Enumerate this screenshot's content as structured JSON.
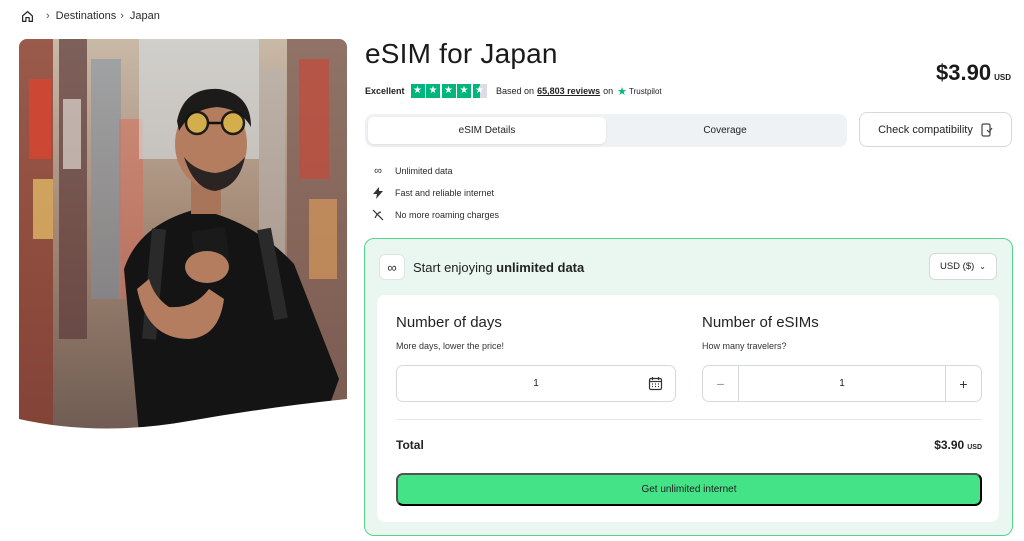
{
  "breadcrumb": {
    "home_icon": "home-icon",
    "items": [
      "Destinations",
      "Japan"
    ]
  },
  "product": {
    "title": "eSIM for Japan",
    "price": "$3.90",
    "currency": "USD"
  },
  "trustpilot": {
    "rating_text": "Excellent",
    "stars": 4.5,
    "based_on": "Based on",
    "review_count": "65,803 reviews",
    "on": "on",
    "brand": "Trustpilot"
  },
  "tabs": [
    {
      "label": "eSIM Details",
      "active": true
    },
    {
      "label": "Coverage",
      "active": false
    }
  ],
  "check_compatibility": {
    "label": "Check compatibility",
    "icon": "device-check-icon"
  },
  "features": [
    {
      "icon": "infinity-icon",
      "label": "Unlimited data"
    },
    {
      "icon": "lightning-icon",
      "label": "Fast and reliable internet"
    },
    {
      "icon": "no-roaming-icon",
      "label": "No more roaming charges"
    }
  ],
  "plan": {
    "header_prefix": "Start enjoying",
    "header_bold": "unlimited data",
    "currency_select": "USD ($)",
    "days": {
      "title": "Number of days",
      "subtitle": "More days, lower the price!",
      "value": "1"
    },
    "esims": {
      "title": "Number of eSIMs",
      "subtitle": "How many travelers?",
      "value": "1"
    },
    "total_label": "Total",
    "total_amount": "$3.90",
    "total_currency": "USD",
    "cta_label": "Get unlimited internet"
  },
  "colors": {
    "accent": "#45e388",
    "card_bg": "#eaf7f0",
    "card_border": "#57d48b",
    "trustpilot_green": "#00b67a"
  }
}
